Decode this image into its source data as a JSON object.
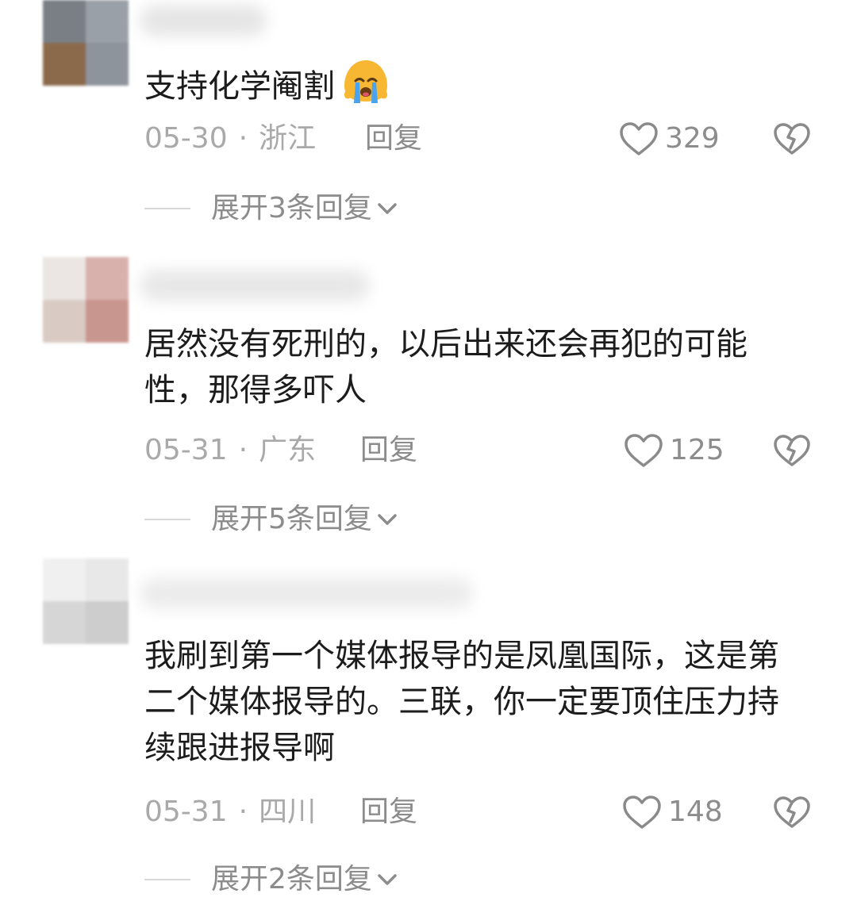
{
  "comments": [
    {
      "text": "支持化学阉割",
      "emoji": "crying-face-emoji",
      "date": "05-30",
      "location": "浙江",
      "reply_label": "回复",
      "likes": "329",
      "expand_label": "展开3条回复"
    },
    {
      "text": "居然没有死刑的，以后出来还会再犯的可能性，那得多吓人",
      "date": "05-31",
      "location": "广东",
      "reply_label": "回复",
      "likes": "125",
      "expand_label": "展开5条回复"
    },
    {
      "text": "我刷到第一个媒体报导的是凤凰国际，这是第二个媒体报导的。三联，你一定要顶住压力持续跟进报导啊",
      "date": "05-31",
      "location": "四川",
      "reply_label": "回复",
      "likes": "148",
      "expand_label": "展开2条回复"
    }
  ],
  "separator": "·",
  "colors": {
    "text": "#1c1c1c",
    "meta": "#a9a9a9",
    "secondary": "#8c8c8c",
    "icon": "#8a8a8a"
  },
  "icons": {
    "like": "heart-outline-icon",
    "dislike": "broken-heart-icon",
    "expand": "chevron-down-icon"
  }
}
